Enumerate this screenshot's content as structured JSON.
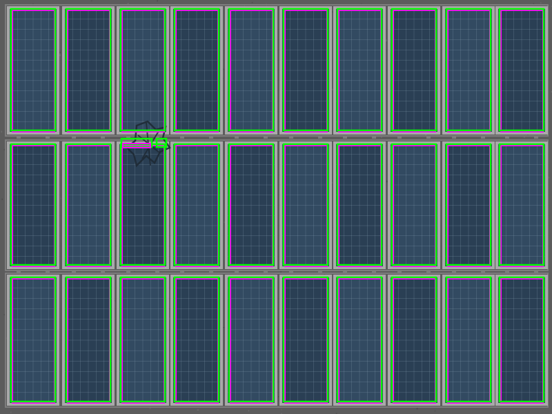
{
  "scene": {
    "subject": "solar-panel-array",
    "rows": 3,
    "panels_per_row": 10,
    "detection_count": 31
  },
  "colors": {
    "ground": "#5c5c5c",
    "ground_speck": "#6e6e6e",
    "panel_frame": "#a9a9a9",
    "panel_frame_dark": "#7d7d7d",
    "panel_cell": "#324a61",
    "panel_cell_dark": "#2a3f54",
    "cell_grid": "#8ea4b8",
    "bbox_primary": "#00ff00",
    "bbox_secondary": "#ff00ff",
    "shadow": "#1e2a35"
  },
  "overlays": {
    "primary_label": "green-detection-box",
    "secondary_label": "magenta-detection-box"
  },
  "icons": {
    "debris": "debris-shadow-icon"
  }
}
